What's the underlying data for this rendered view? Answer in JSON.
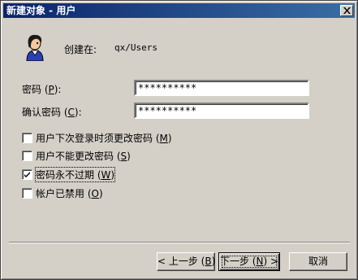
{
  "window": {
    "title": "新建对象 - 用户",
    "close_symbol": "×"
  },
  "header": {
    "icon": "user-icon",
    "created_label": "创建在:",
    "created_value": "qx/Users"
  },
  "fields": {
    "password": {
      "label_prefix": "密码 (",
      "hotkey": "P",
      "label_suffix": "):",
      "value": "**********"
    },
    "confirm": {
      "label_prefix": "确认密码 (",
      "hotkey": "C",
      "label_suffix": "):",
      "value": "**********"
    }
  },
  "options": [
    {
      "label_prefix": "用户下次登录时须更改密码 (",
      "hotkey": "M",
      "label_suffix": ")",
      "checked": false
    },
    {
      "label_prefix": "用户不能更改密码 (",
      "hotkey": "S",
      "label_suffix": ")",
      "checked": false
    },
    {
      "label_prefix": "密码永不过期 (",
      "hotkey": "W",
      "label_suffix": ")",
      "checked": true
    },
    {
      "label_prefix": "帐户已禁用 (",
      "hotkey": "O",
      "label_suffix": ")",
      "checked": false
    }
  ],
  "buttons": {
    "back": {
      "prefix": "< 上一步 (",
      "hotkey": "B",
      "suffix": ")"
    },
    "next": {
      "prefix": "下一步 (",
      "hotkey": "N",
      "suffix": ") >"
    },
    "cancel": {
      "label": "取消"
    }
  }
}
